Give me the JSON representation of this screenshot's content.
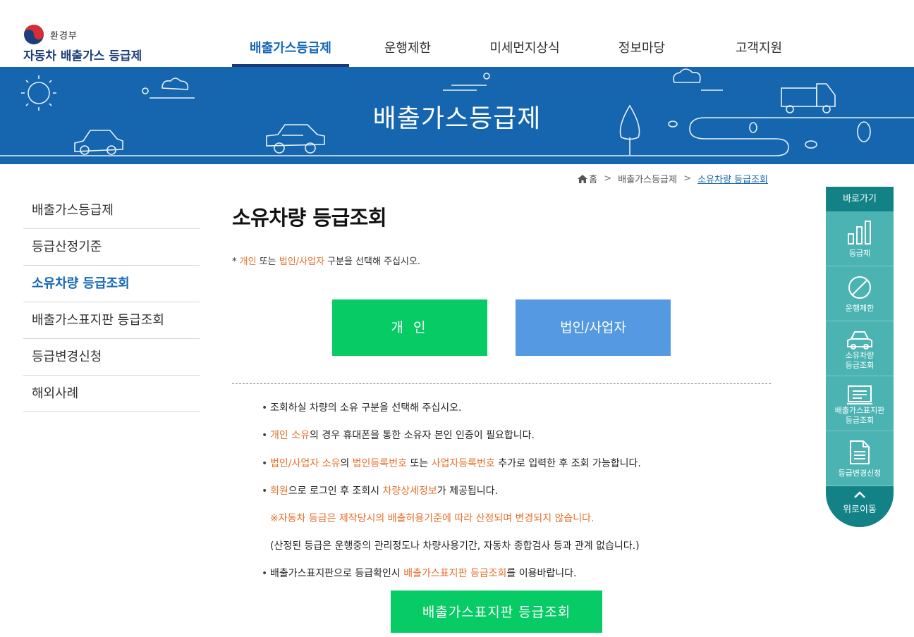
{
  "header": {
    "ministry": "환경부",
    "site_title": "자동차 배출가스 등급제",
    "gnb": [
      {
        "label": "배출가스등급제",
        "active": true
      },
      {
        "label": "운행제한",
        "active": false
      },
      {
        "label": "미세먼지상식",
        "active": false
      },
      {
        "label": "정보마당",
        "active": false
      },
      {
        "label": "고객지원",
        "active": false
      }
    ]
  },
  "banner": {
    "title": "배출가스등급제"
  },
  "breadcrumb": {
    "home": "홈",
    "section": "배출가스등급제",
    "current": "소유차량 등급조회"
  },
  "lnb": [
    {
      "label": "배출가스등급제",
      "active": false
    },
    {
      "label": "등급산정기준",
      "active": false
    },
    {
      "label": "소유차량 등급조회",
      "active": true
    },
    {
      "label": "배출가스표지판 등급조회",
      "active": false
    },
    {
      "label": "등급변경신청",
      "active": false
    },
    {
      "label": "해외사례",
      "active": false
    }
  ],
  "content": {
    "title": "소유차량 등급조회",
    "notice": {
      "prefix": "* ",
      "personal": "개인",
      "or": " 또는 ",
      "corp": "법인/사업자",
      "suffix": " 구분을 선택해 주십시오."
    },
    "btn_personal": "개 인",
    "btn_corp": "법인/사업자",
    "info": {
      "l1": "조회하실 차량의 소유 구분을 선택해 주십시오.",
      "l2_a": "개인 소유",
      "l2_b": "의 경우 휴대폰을 통한 소유자 본인 인증이 필요합니다.",
      "l3_a": "법인/사업자 소유",
      "l3_b": "의 ",
      "l3_c": "법인등록번호",
      "l3_d": " 또는 ",
      "l3_e": "사업자등록번호",
      "l3_f": " 추가로 입력한 후 조회 가능합니다.",
      "l4_a": "회원",
      "l4_b": "으로 로그인 후 조회시 ",
      "l4_c": "차량상세정보",
      "l4_d": "가 제공됩니다.",
      "l5": "※자동차 등급은 제작당시의 배출허용기준에 따라 산정되며 변경되지 않습니다.",
      "l6": "(산정된 등급은 운행중의 관리정도나 차량사용기간, 자동차 종합검사 등과 관계 없습니다.)",
      "l7_a": "배출가스표지판으로 등급확인시 ",
      "l7_b": "배출가스표지판 등급조회",
      "l7_c": "를 이용바랍니다."
    },
    "btn_sign": "배출가스표지판 등급조회"
  },
  "quick": {
    "head": "바로가기",
    "items": [
      {
        "label": "등급제",
        "icon": "bar-chart-icon"
      },
      {
        "label": "운행제한",
        "icon": "prohibited-icon"
      },
      {
        "label": "소유차량\n등급조회",
        "icon": "car-icon"
      },
      {
        "label": "배출가스표지판\n등급조회",
        "icon": "sign-board-icon"
      },
      {
        "label": "등급변경신청",
        "icon": "document-icon"
      }
    ],
    "top": "위로이동"
  },
  "colors": {
    "primary": "#1566ae",
    "green": "#07cc65",
    "blue": "#5599e2",
    "teal": "#4cb3b3",
    "orange": "#e8702e"
  }
}
